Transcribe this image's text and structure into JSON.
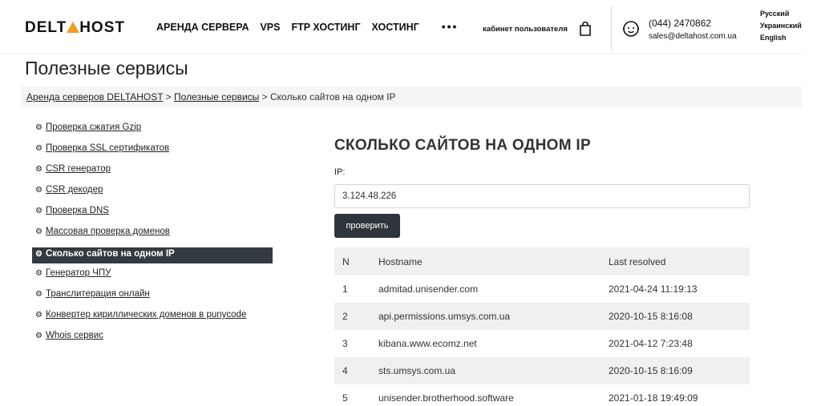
{
  "header": {
    "logo_left": "DELT",
    "logo_right": "HOST",
    "nav": [
      "АРЕНДА СЕРВЕРА",
      "VPS",
      "FTP ХОСТИНГ",
      "ХОСТИНГ"
    ],
    "more": "•••",
    "cabinet": "кабинет пользователя",
    "phone": "(044) 2470862",
    "email": "sales@deltahost.com.ua",
    "languages": [
      "Русский",
      "Украинский",
      "English"
    ],
    "accent_color": "#f29b1d"
  },
  "page": {
    "title": "Полезные сервисы",
    "breadcrumb": {
      "items": [
        "Аренда серверов DELTAHOST",
        "Полезные сервисы"
      ],
      "separator": ">",
      "current": "Сколько сайтов на одном IP"
    }
  },
  "sidebar": {
    "icon": "gear-icon",
    "items": [
      {
        "label": "Проверка сжатия Gzip",
        "active": false
      },
      {
        "label": "Проверка SSL сертификатов",
        "active": false
      },
      {
        "label": "CSR генератор",
        "active": false
      },
      {
        "label": "CSR декодер",
        "active": false
      },
      {
        "label": "Проверка DNS",
        "active": false
      },
      {
        "label": "Массовая проверка доменов",
        "active": false
      },
      {
        "label": "Сколько сайтов на одном IP",
        "active": true
      },
      {
        "label": "Генератор ЧПУ",
        "active": false
      },
      {
        "label": "Транслитерация онлайн",
        "active": false
      },
      {
        "label": "Конвертер кириллических доменов в punycode",
        "active": false
      },
      {
        "label": "Whois сервис",
        "active": false
      }
    ]
  },
  "main": {
    "title": "СКОЛЬКО САЙТОВ НА ОДНОМ IP",
    "ip_label": "IP:",
    "ip_value": "3.124.48.226",
    "button": "проверить",
    "table": {
      "headers": [
        "N",
        "Hostname",
        "Last resolved"
      ],
      "rows": [
        [
          "1",
          "admitad.unisender.com",
          "2021-04-24 11:19:13"
        ],
        [
          "2",
          "api.permissions.umsys.com.ua",
          "2020-10-15 8:16:08"
        ],
        [
          "3",
          "kibana.www.ecomz.net",
          "2021-04-12 7:23:48"
        ],
        [
          "4",
          "sts.umsys.com.ua",
          "2020-10-15 8:16:09"
        ],
        [
          "5",
          "unisender.brotherhood.software",
          "2021-01-18 19:49:09"
        ]
      ]
    }
  }
}
